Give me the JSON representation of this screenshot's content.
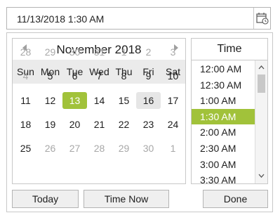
{
  "input": {
    "value": "11/13/2018 1:30 AM"
  },
  "calendar": {
    "month_title": "November 2018",
    "weekdays": [
      "Sun",
      "Mon",
      "Tue",
      "Wed",
      "Thu",
      "Fri",
      "Sat"
    ],
    "weeks": [
      [
        {
          "d": "28",
          "other": true
        },
        {
          "d": "29",
          "other": true
        },
        {
          "d": "30",
          "other": true
        },
        {
          "d": "31",
          "other": true
        },
        {
          "d": "1",
          "other": true
        },
        {
          "d": "2",
          "other": true
        },
        {
          "d": "3",
          "other": true
        }
      ],
      [
        {
          "d": "4",
          "other": true
        },
        {
          "d": "5"
        },
        {
          "d": "6"
        },
        {
          "d": "7"
        },
        {
          "d": "8"
        },
        {
          "d": "9"
        },
        {
          "d": "10"
        }
      ],
      [
        {
          "d": "11"
        },
        {
          "d": "12"
        },
        {
          "d": "13",
          "selected": true
        },
        {
          "d": "14"
        },
        {
          "d": "15"
        },
        {
          "d": "16",
          "today": true
        },
        {
          "d": "17"
        }
      ],
      [
        {
          "d": "18"
        },
        {
          "d": "19"
        },
        {
          "d": "20"
        },
        {
          "d": "21"
        },
        {
          "d": "22"
        },
        {
          "d": "23"
        },
        {
          "d": "24"
        }
      ],
      [
        {
          "d": "25"
        },
        {
          "d": "26",
          "other": true
        },
        {
          "d": "27",
          "other": true
        },
        {
          "d": "28",
          "other": true
        },
        {
          "d": "29",
          "other": true
        },
        {
          "d": "30",
          "other": true
        },
        {
          "d": "1",
          "other": true
        }
      ]
    ]
  },
  "time": {
    "header": "Time",
    "items": [
      "12:00 AM",
      "12:30 AM",
      "1:00 AM",
      "1:30 AM",
      "2:00 AM",
      "2:30 AM",
      "3:00 AM",
      "3:30 AM"
    ],
    "selected_index": 3
  },
  "buttons": {
    "today": "Today",
    "time_now": "Time Now",
    "done": "Done"
  },
  "colors": {
    "accent": "#a1c23a",
    "today_bg": "#e6e6e6",
    "header_bg": "#ebebeb"
  }
}
